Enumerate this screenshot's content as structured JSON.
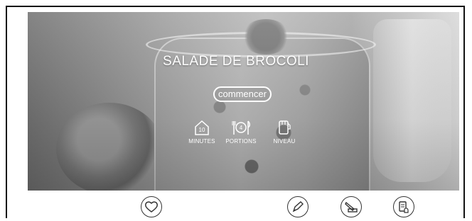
{
  "recipe": {
    "title": "SALADE DE BROCOLI",
    "start_label": "commencer",
    "stats": {
      "minutes": {
        "value": "10",
        "label": "MINUTES"
      },
      "portions": {
        "value": "4",
        "label": "PORTIONS"
      },
      "niveau": {
        "label": "NIVEAU"
      }
    }
  },
  "actions": {
    "icons": [
      "heart-icon",
      "pen-icon",
      "knife-board-icon",
      "recipe-hand-icon"
    ]
  }
}
